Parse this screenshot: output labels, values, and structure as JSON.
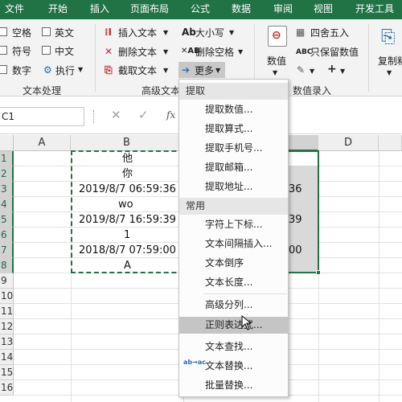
{
  "tabs": [
    "文件",
    "开始",
    "插入",
    "页面布局",
    "公式",
    "数据",
    "审阅",
    "视图",
    "开发工具"
  ],
  "ribbon": {
    "text_group": {
      "checkboxes": [
        "空格",
        "英文",
        "符号",
        "中文",
        "数字"
      ],
      "exec_label": "执行",
      "group_label": "文本处理"
    },
    "advanced_group": {
      "insert_text": "插入文本",
      "delete_text": "删除文本",
      "extract_text": "截取文本",
      "case_label": "大小写",
      "delete_space": "删除空格",
      "more_label": "更多",
      "group_label": "高级文本"
    },
    "numeric_group": {
      "numeric_label": "数值",
      "round_label": "四舍五入",
      "keep_values": "只保留数值",
      "plus_label": "+",
      "group_label": "数值录入"
    },
    "copy_label": "复制粘"
  },
  "formula_bar": {
    "name_box": "C1",
    "fx": "fx"
  },
  "grid": {
    "columns": [
      "A",
      "B",
      "C",
      "D"
    ],
    "rows": [
      "1",
      "2",
      "3",
      "4",
      "5",
      "6",
      "7",
      "8",
      "9",
      "10",
      "11",
      "12",
      "13",
      "14",
      "15",
      "16"
    ],
    "b_cells": [
      "他",
      "你",
      "2019/8/7  06:59:36",
      "wo",
      "2019/8/7  16:59:39",
      "1",
      "2018/8/7  07:59:00",
      "A"
    ],
    "c_visible": [
      "36",
      "39",
      "00"
    ]
  },
  "menu": {
    "section1": "提取",
    "extract_items": [
      "提取数值...",
      "提取算式...",
      "提取手机号...",
      "提取邮箱...",
      "提取地址..."
    ],
    "section2": "常用",
    "common_items": [
      "字符上下标...",
      "文本间隔插入...",
      "文本倒序",
      "文本长度...",
      "高级分列...",
      "正则表达式...",
      "文本查找...",
      "文本替换...",
      "批量替换..."
    ],
    "replace_icon_text": "ab→ac"
  },
  "colors": {
    "brand": "#217346",
    "selection": "#d9d9d9",
    "highlight": "#c5c5c5"
  }
}
